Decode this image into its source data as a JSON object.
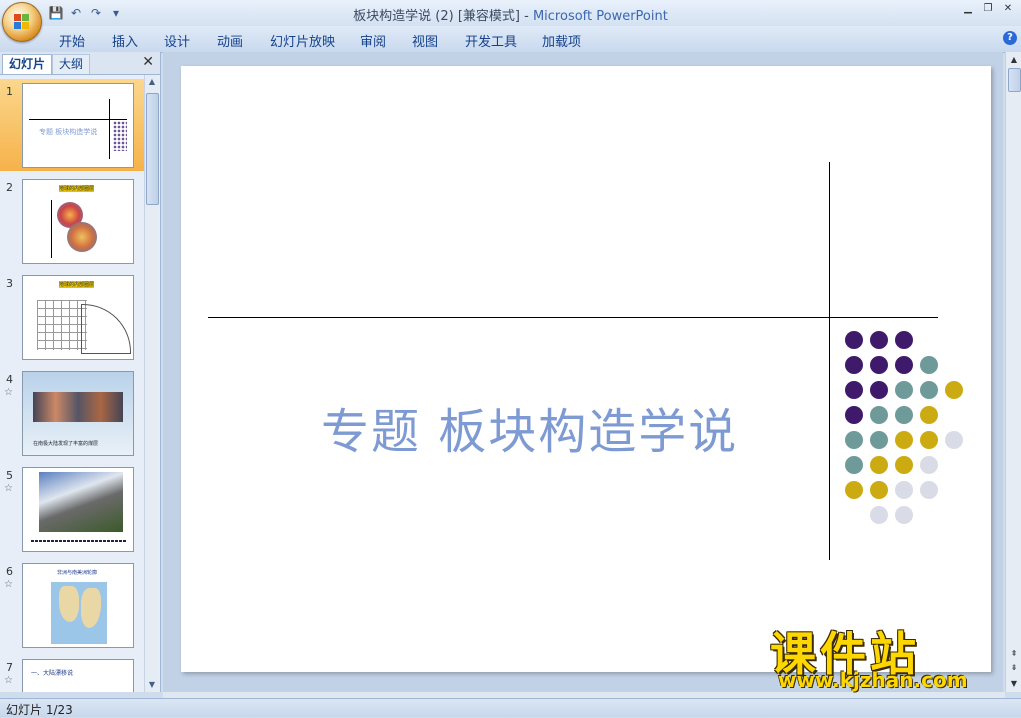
{
  "window": {
    "title_doc": "板块构造学说 (2) [兼容模式] - ",
    "title_app": "Microsoft PowerPoint"
  },
  "ribbon": {
    "tabs": [
      "开始",
      "插入",
      "设计",
      "动画",
      "幻灯片放映",
      "审阅",
      "视图",
      "开发工具",
      "加载项"
    ]
  },
  "left_pane": {
    "tab_slides": "幻灯片",
    "tab_outline": "大纲",
    "thumbnails": [
      {
        "num": "1",
        "star": "",
        "caption": "专题   板块构造学说"
      },
      {
        "num": "2",
        "star": "",
        "caption": "地球的内部圈层"
      },
      {
        "num": "3",
        "star": "",
        "caption": "地球的内部圈层"
      },
      {
        "num": "4",
        "star": "☆",
        "caption": "在南极大陆发现了丰富的煤层"
      },
      {
        "num": "5",
        "star": "☆",
        "caption": ""
      },
      {
        "num": "6",
        "star": "☆",
        "caption": "非洲与南美洲轮廓"
      },
      {
        "num": "7",
        "star": "☆",
        "caption": "一、大陆漂移说"
      }
    ]
  },
  "slide": {
    "title": "专题   板块构造学说",
    "dot_colors": {
      "purple": "#3f1a6b",
      "teal": "#6f9a9a",
      "gold": "#ccab12",
      "light": "#d9dbe6"
    }
  },
  "status": {
    "text": "幻灯片 1/23"
  },
  "watermark": {
    "big": "课件站",
    "url": "www.kjzhan.com"
  }
}
